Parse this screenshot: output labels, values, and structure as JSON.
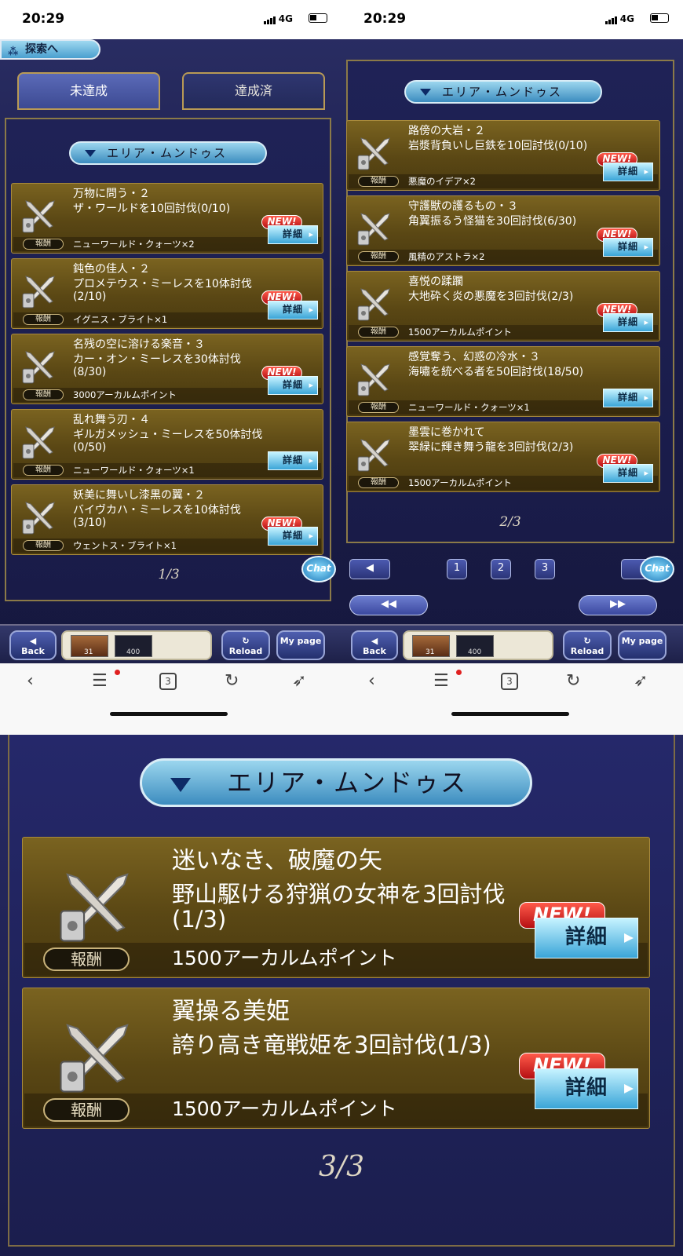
{
  "status_bar": {
    "time": "20:29",
    "network": "4G"
  },
  "nav": {
    "explore_label": "探索へ",
    "back": "Back",
    "reload": "Reload",
    "mypage": "My page",
    "chat": "Chat",
    "item_count": "400",
    "thumb_num": "31"
  },
  "tabs": {
    "incomplete": "未達成",
    "complete": "達成済"
  },
  "area_label": "エリア・ムンドゥス",
  "reward_label": "報酬",
  "new_label": "NEW!",
  "detail_label": "詳細",
  "left": {
    "pager": "1/3",
    "missions": [
      {
        "title": "万物に問う・２",
        "desc": "ザ・ワールドを10回討伐(0/10)",
        "reward": "ニューワールド・クォーツ×2",
        "new": true
      },
      {
        "title": "鈍色の佳人・２",
        "desc": "プロメテウス・ミーレスを10体討伐(2/10)",
        "reward": "イグニス・ブライト×1",
        "new": true
      },
      {
        "title": "名残の空に溶ける楽音・３",
        "desc": "カー・オン・ミーレスを30体討伐(8/30)",
        "reward": "3000アーカルムポイント",
        "new": true
      },
      {
        "title": "乱れ舞う刃・４",
        "desc": "ギルガメッシュ・ミーレスを50体討伐(0/50)",
        "reward": "ニューワールド・クォーツ×1",
        "new": false
      },
      {
        "title": "妖美に舞いし漆黒の翼・２",
        "desc": "バイヴカハ・ミーレスを10体討伐(3/10)",
        "reward": "ウェントス・ブライト×1",
        "new": true
      }
    ]
  },
  "right": {
    "pager": "2/3",
    "page_buttons": [
      "1",
      "2",
      "3"
    ],
    "missions": [
      {
        "title": "路傍の大岩・２",
        "desc": "岩漿背負いし巨鉄を10回討伐(0/10)",
        "reward": "悪魔のイデア×2",
        "new": true
      },
      {
        "title": "守護獣の護るもの・３",
        "desc": "角翼振るう怪猫を30回討伐(6/30)",
        "reward": "風精のアストラ×2",
        "new": true
      },
      {
        "title": "喜悦の蹂躙",
        "desc": "大地砕く炎の悪魔を3回討伐(2/3)",
        "reward": "1500アーカルムポイント",
        "new": true
      },
      {
        "title": "感覚奪う、幻惑の冷水・３",
        "desc": "海嘯を統べる者を50回討伐(18/50)",
        "reward": "ニューワールド・クォーツ×1",
        "new": false
      },
      {
        "title": "墨雲に巻かれて",
        "desc": "翠緑に輝き舞う龍を3回討伐(2/3)",
        "reward": "1500アーカルムポイント",
        "new": true
      }
    ]
  },
  "zoom": {
    "pager": "3/3",
    "missions": [
      {
        "title": "迷いなき、破魔の矢",
        "desc": "野山駆ける狩猟の女神を3回討伐(1/3)",
        "reward": "1500アーカルムポイント",
        "new": true
      },
      {
        "title": "翼操る美姫",
        "desc": "誇り高き竜戦姫を3回討伐(1/3)",
        "reward": "1500アーカルムポイント",
        "new": true
      }
    ]
  },
  "browser": {
    "tab_count": "3"
  }
}
